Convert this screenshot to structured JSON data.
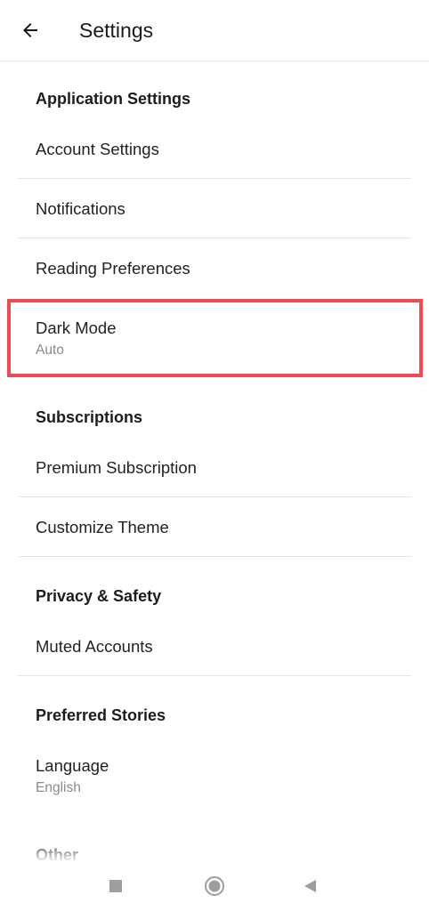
{
  "appbar": {
    "title": "Settings",
    "back_icon": "arrow-left-icon"
  },
  "sections": {
    "application": {
      "header": "Application Settings",
      "account": "Account Settings",
      "notifications": "Notifications",
      "reading": "Reading Preferences",
      "dark_mode": {
        "label": "Dark Mode",
        "value": "Auto"
      }
    },
    "subscriptions": {
      "header": "Subscriptions",
      "premium": "Premium Subscription",
      "theme": "Customize Theme"
    },
    "privacy": {
      "header": "Privacy & Safety",
      "muted": "Muted Accounts"
    },
    "stories": {
      "header": "Preferred Stories",
      "language": {
        "label": "Language",
        "value": "English"
      }
    },
    "other": {
      "header": "Other"
    }
  },
  "navbar": {
    "recents_icon": "square-icon",
    "home_icon": "circle-home-icon",
    "back_icon": "triangle-back-icon"
  },
  "colors": {
    "highlight": "#ec4b58",
    "divider": "#e4e4e4",
    "subtext": "#8a8a8a",
    "nav_icon": "#9e9e9e"
  }
}
